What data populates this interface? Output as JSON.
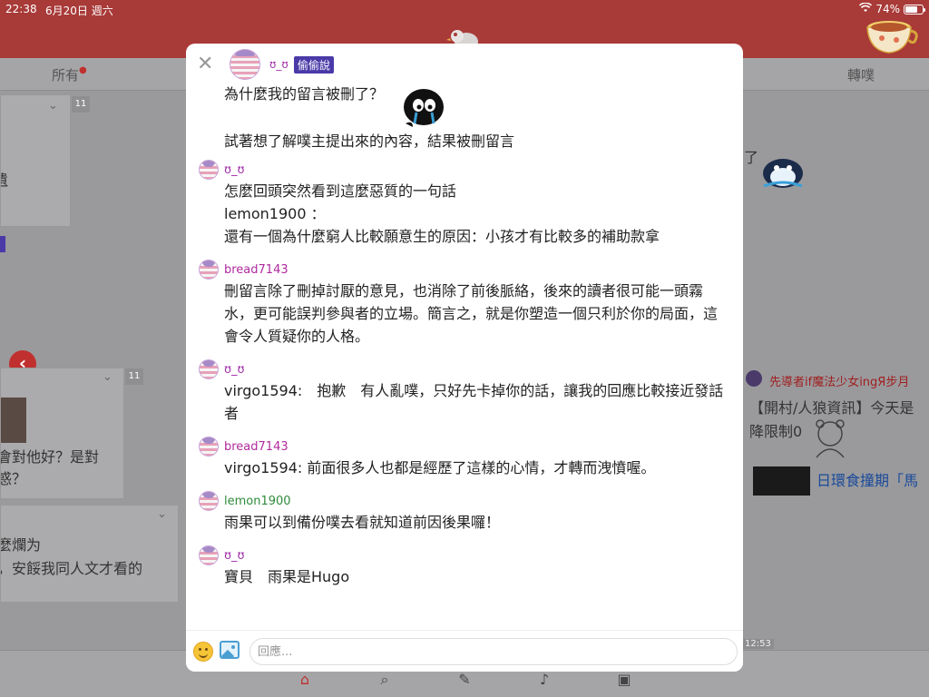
{
  "status_bar": {
    "time": "22:38",
    "date": "6月20日 週六",
    "battery": "74%",
    "battery_level": 0.74
  },
  "tabs": {
    "all": "所有",
    "replurk": "轉噗"
  },
  "background": {
    "count_1": "11",
    "count_2": "11",
    "text_1": "會對他好？是對",
    "text_2": "惑？",
    "text_3": "麼爛为",
    "text_4": "，安餒我同人文才看的",
    "right_username": "先導者if魔法少女ingЯ步月",
    "right_text_1": "【開村/人狼資訊】今天是",
    "right_text_2": "降限制0",
    "right_text_3": "日環食撞期「馬",
    "left_text_top": "了",
    "time_stamp": "12:53"
  },
  "post": {
    "author": "ʊ_ʊ",
    "badge": "偷偷說",
    "line1": "為什麼我的留言被刪了？",
    "line2": "試著想了解噗主提出來的內容，結果被刪留言"
  },
  "replies": [
    {
      "author": "ʊ_ʊ",
      "color": "#a02fa8",
      "text": "怎麼回頭突然看到這麼惡質的一句話\nlemon1900 ：\n還有一個為什麼窮人比較願意生的原因：小孩才有比較多的補助款拿"
    },
    {
      "author": "bread7143",
      "color": "#b02a9e",
      "text": "刪留言除了刪掉討厭的意見，也消除了前後脈絡，後來的讀者很可能一頭霧水，更可能誤判參與者的立場。簡言之，就是你塑造一個只利於你的局面，這會令人質疑你的人格。"
    },
    {
      "author": "ʊ_ʊ",
      "color": "#a02fa8",
      "text": "virgo1594:　抱歉　有人亂噗，只好先卡掉你的話，讓我的回應比較接近發話者"
    },
    {
      "author": "bread7143",
      "color": "#b02a9e",
      "text": "virgo1594: 前面很多人也都是經歷了這樣的心情，才轉而洩憤喔。"
    },
    {
      "author": "lemon1900",
      "color": "#2e8b3a",
      "text": "雨果可以到備份噗去看就知道前因後果囉！"
    },
    {
      "author": "ʊ_ʊ",
      "color": "#a02fa8",
      "text": "寶貝　雨果是Hugo"
    }
  ],
  "reply_bar": {
    "placeholder": "回應..."
  },
  "colors": {
    "header": "#a83a38",
    "accent": "#c0302e"
  }
}
